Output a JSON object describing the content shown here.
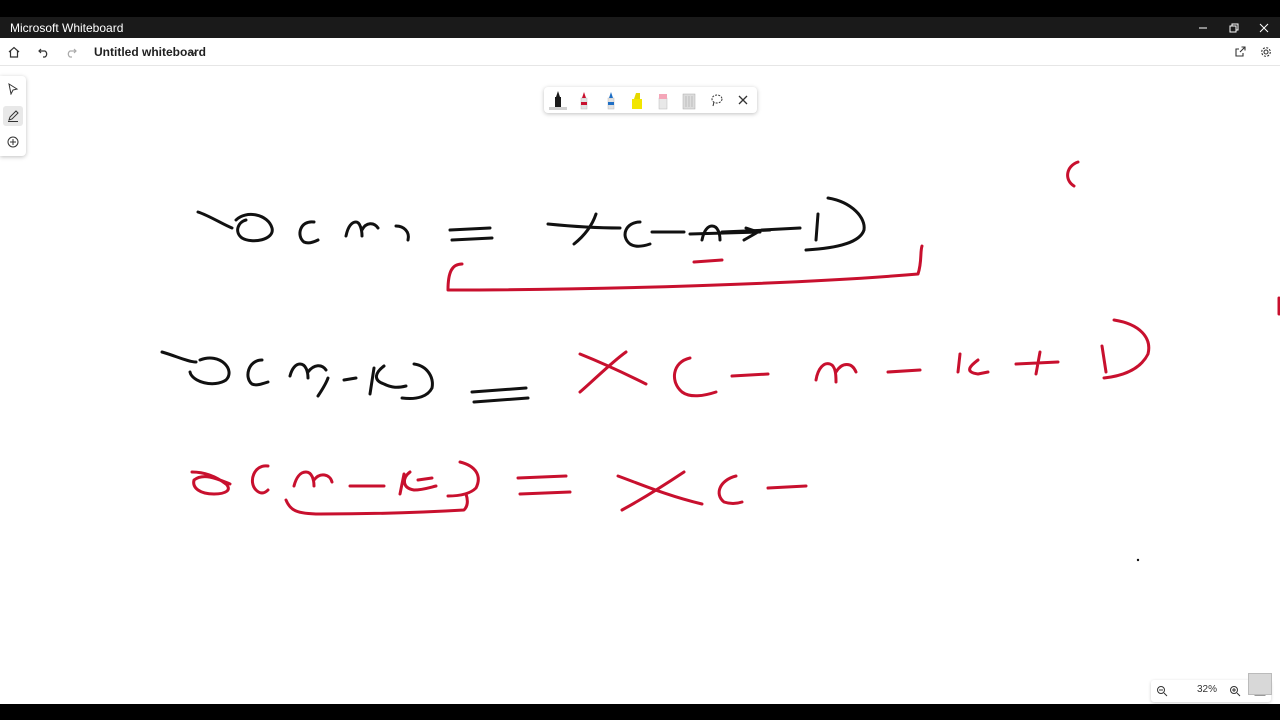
{
  "window": {
    "title": "Microsoft Whiteboard"
  },
  "appbar": {
    "document_name": "Untitled whiteboard"
  },
  "pen_tray": {
    "pens": [
      {
        "name": "black-pen",
        "color": "#1a1a1a",
        "selected": true
      },
      {
        "name": "red-pen",
        "color": "#c8102e",
        "selected": false
      },
      {
        "name": "blue-pen",
        "color": "#1f6fc5",
        "selected": false
      },
      {
        "name": "yellow-highlighter",
        "color": "#f2e600",
        "selected": false
      },
      {
        "name": "pink-eraser",
        "color": "#f4a6b8",
        "selected": false
      },
      {
        "name": "ruler",
        "color": "#cfcfcf",
        "selected": false
      }
    ]
  },
  "zoom": {
    "level": "32%"
  },
  "colors": {
    "ink_black": "#111111",
    "ink_red": "#c8102e"
  }
}
